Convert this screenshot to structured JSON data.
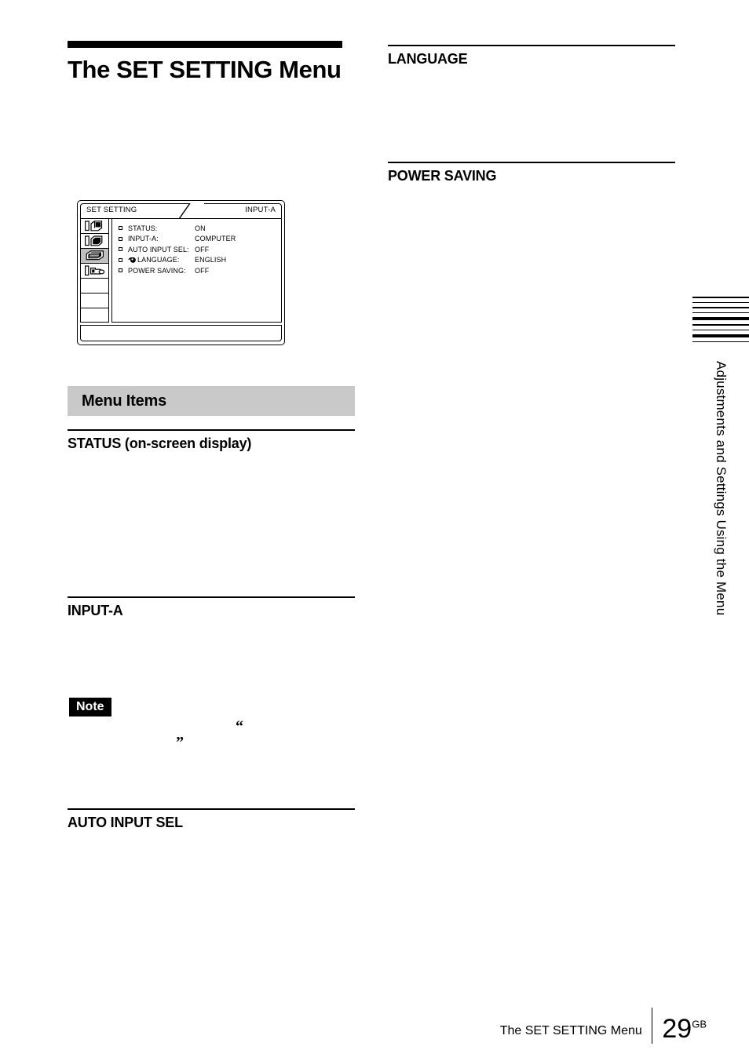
{
  "page": {
    "chapter_title": "The SET SETTING Menu",
    "section_band_label": "Menu Items"
  },
  "left_column": {
    "headings": [
      {
        "id": "status",
        "text": "STATUS (on-screen display)"
      },
      {
        "id": "input-a",
        "text": "INPUT-A"
      },
      {
        "id": "auto-input-sel",
        "text": "AUTO INPUT SEL"
      }
    ],
    "note": {
      "badge_label": "Note",
      "open_quote": "“",
      "close_quote": "”"
    }
  },
  "right_column": {
    "headings": [
      {
        "id": "language",
        "text": "LANGUAGE"
      },
      {
        "id": "power-saving",
        "text": "POWER SAVING"
      }
    ]
  },
  "osd_figure": {
    "tab_left_label": "SET SETTING",
    "tab_right_label": "INPUT-A",
    "rail": {
      "icons": [
        {
          "name": "picture-icon",
          "selected": false
        },
        {
          "name": "screen-icon",
          "selected": false
        },
        {
          "name": "set-setting-icon",
          "selected": true
        },
        {
          "name": "installation-icon",
          "selected": false
        }
      ],
      "empty_cells": 3
    },
    "items": [
      {
        "label": "STATUS:",
        "value": "ON",
        "icon": null
      },
      {
        "label": "INPUT-A:",
        "value": "COMPUTER",
        "icon": null
      },
      {
        "label": "AUTO INPUT SEL:",
        "value": "OFF",
        "icon": null
      },
      {
        "label": "LANGUAGE:",
        "value": "ENGLISH",
        "icon": "globe-icon"
      },
      {
        "label": "POWER SAVING:",
        "value": "OFF",
        "icon": null
      }
    ]
  },
  "edge_tab": {
    "label": "Adjustments and Settings Using the Menu",
    "line_weights": [
      "thin",
      "thin",
      "thin",
      "thin",
      "thick",
      "thin",
      "thin",
      "thick",
      "thin"
    ]
  },
  "footer": {
    "caption": "The SET SETTING Menu",
    "page_number": "29",
    "region_code": "GB"
  },
  "colors": {
    "band_gray": "#c9c9c9",
    "selected_gray": "#c0c0c0",
    "ink": "#000000",
    "paper": "#ffffff"
  }
}
